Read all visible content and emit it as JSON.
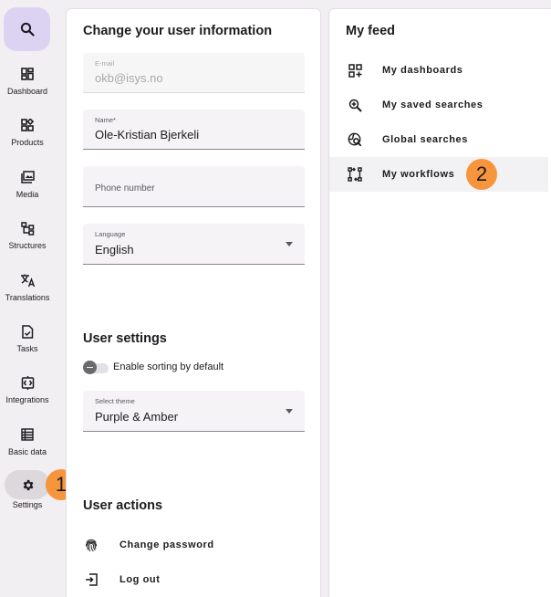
{
  "sidebar": {
    "search_icon": "search-icon",
    "items": [
      {
        "label": "Dashboard",
        "icon": "dashboard-icon"
      },
      {
        "label": "Products",
        "icon": "products-icon"
      },
      {
        "label": "Media",
        "icon": "media-icon"
      },
      {
        "label": "Structures",
        "icon": "structures-icon"
      },
      {
        "label": "Translations",
        "icon": "translate-icon"
      },
      {
        "label": "Tasks",
        "icon": "tasks-icon"
      },
      {
        "label": "Integrations",
        "icon": "integrations-icon"
      },
      {
        "label": "Basic data",
        "icon": "basic-data-icon"
      },
      {
        "label": "Settings",
        "icon": "gear-icon",
        "active": true
      }
    ]
  },
  "markers": {
    "one": "1",
    "two": "2"
  },
  "user_info": {
    "title": "Change your user information",
    "email": {
      "label": "E-mail",
      "value": "okb@isys.no",
      "disabled": true
    },
    "name": {
      "label": "Name*",
      "value": "Ole-Kristian Bjerkeli"
    },
    "phone": {
      "placeholder": "Phone number"
    },
    "language": {
      "label": "Language",
      "value": "English"
    }
  },
  "user_settings": {
    "title": "User settings",
    "sorting_toggle_label": "Enable sorting by default",
    "theme": {
      "label": "Select theme",
      "value": "Purple & Amber"
    }
  },
  "user_actions": {
    "title": "User actions",
    "change_password": "Change password",
    "log_out": "Log out"
  },
  "feed": {
    "title": "My feed",
    "items": [
      {
        "label": "My dashboards",
        "icon": "dashboard-add-icon"
      },
      {
        "label": "My saved searches",
        "icon": "zoom-in-icon"
      },
      {
        "label": "Global searches",
        "icon": "global-search-icon"
      },
      {
        "label": "My workflows",
        "icon": "workflow-icon",
        "highlighted": true
      }
    ]
  },
  "colors": {
    "accent": "#dcd3f3",
    "marker": "#f7953d",
    "background": "#f2eff2"
  }
}
